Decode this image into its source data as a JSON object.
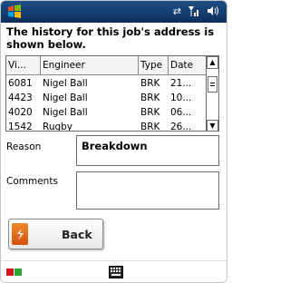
{
  "status_bar": {
    "start_icon": "windows-flag-icon",
    "connectivity_icon": "sync-arrows-icon",
    "signal_icon": "signal-icon",
    "volume_icon": "speaker-icon",
    "colors": {
      "bar_top": "#1f4f86",
      "bar_bottom": "#0d2f5c"
    }
  },
  "heading": "The history for this job's address is shown below.",
  "table": {
    "columns": [
      "Vi...",
      "Engineer",
      "Type",
      "Date"
    ],
    "rows": [
      [
        "6081",
        "Nigel Ball",
        "BRK",
        "21..."
      ],
      [
        "4423",
        "Nigel Ball",
        "BRK",
        "10..."
      ],
      [
        "4020",
        "Nigel Ball",
        "BRK",
        "06..."
      ],
      [
        "1542",
        "Rugby",
        "BRK",
        "26..."
      ]
    ]
  },
  "form": {
    "reason_label": "Reason",
    "reason_value": "Breakdown",
    "comments_label": "Comments",
    "comments_value": ""
  },
  "back_button": {
    "label": "Back",
    "icon": "back-arrow-icon"
  },
  "bottom_bar": {
    "left_icon": "status-squares-icon",
    "keyboard_icon": "keyboard-icon",
    "colors": {
      "red": "#d4151c",
      "green": "#2fa335"
    }
  }
}
